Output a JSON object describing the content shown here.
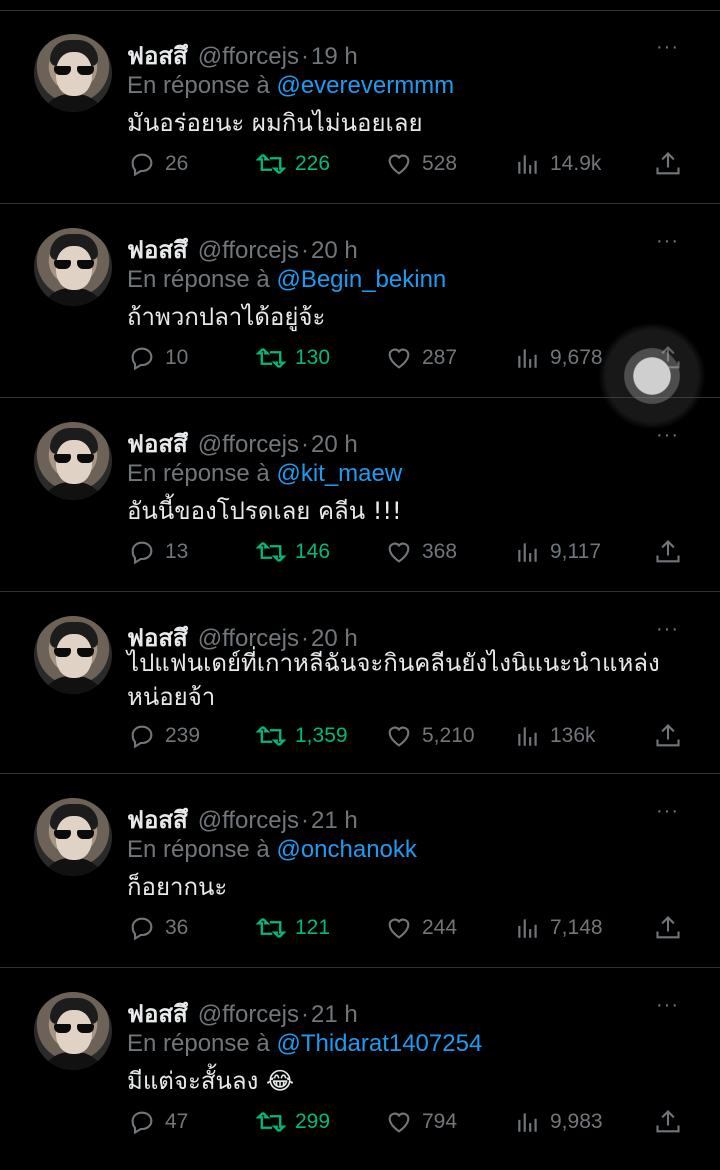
{
  "user": {
    "name": "ฟอสสึ",
    "handle": "@fforcejs"
  },
  "reply_prefix": "En réponse à",
  "more_glyph": "···",
  "icons": {
    "reply": "reply-icon",
    "retweet": "retweet-icon",
    "like": "heart-icon",
    "views": "views-icon",
    "share": "share-icon"
  },
  "tweets": [
    {
      "time": "19 h",
      "reply_to": "@everevermmm",
      "text": "มันอร่อยนะ ผมกินไม่นอยเลย",
      "replies": "26",
      "retweets": "226",
      "likes": "528",
      "views": "14.9k"
    },
    {
      "time": "20 h",
      "reply_to": "@Begin_bekinn",
      "text": "ถ้าพวกปลาได้อยู่จ้ะ",
      "replies": "10",
      "retweets": "130",
      "likes": "287",
      "views": "9,678"
    },
    {
      "time": "20 h",
      "reply_to": "@kit_maew",
      "text": "อันนี้ของโปรดเลย คลีน !!!",
      "replies": "13",
      "retweets": "146",
      "likes": "368",
      "views": "9,117"
    },
    {
      "time": "20 h",
      "reply_to": "",
      "text": "ไปแฟนเดย์ที่เกาหลีฉันจะกินคลีนยังไงนิแนะนำแหล่งหน่อยจ้า",
      "replies": "239",
      "retweets": "1,359",
      "likes": "5,210",
      "views": "136k"
    },
    {
      "time": "21 h",
      "reply_to": "@onchanokk",
      "text": "ก็อยากนะ",
      "replies": "36",
      "retweets": "121",
      "likes": "244",
      "views": "7,148"
    },
    {
      "time": "21 h",
      "reply_to": "@Thidarat1407254",
      "text": "มีแต่จะสั้นลง 😂",
      "replies": "47",
      "retweets": "299",
      "likes": "794",
      "views": "9,983"
    }
  ]
}
